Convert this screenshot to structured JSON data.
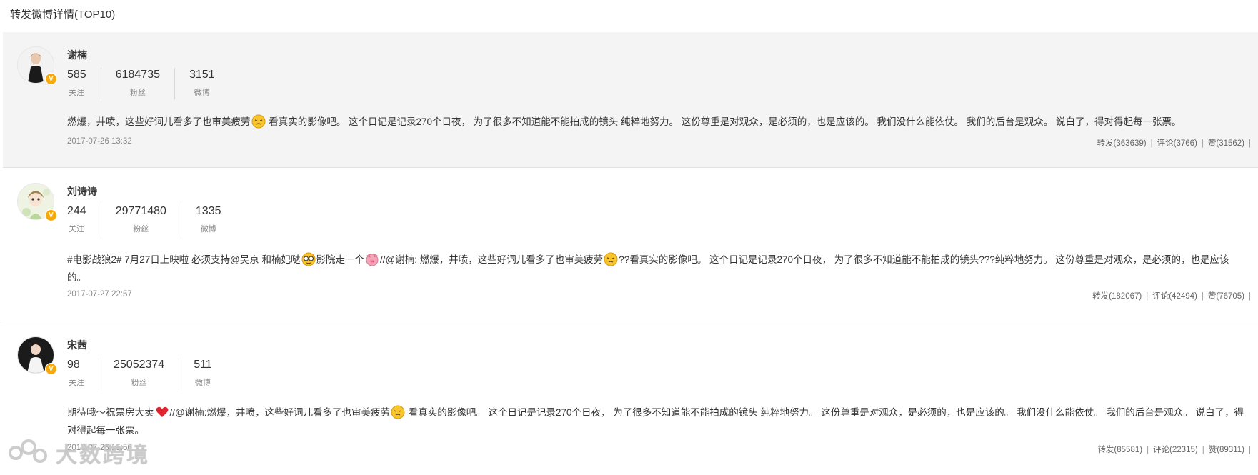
{
  "section_title": "转发微博详情(TOP10)",
  "labels": {
    "follow": "关注",
    "fans": "粉丝",
    "weibo": "微博"
  },
  "colors": {
    "badge": "#f7a90a",
    "highlight_bg": "#f4f4f4"
  },
  "posts": [
    {
      "name": "谢楠",
      "follow": "585",
      "fans": "6184735",
      "weibo": "3151",
      "content_a": "燃爆，井喷，这些好词儿看多了也审美疲劳",
      "content_b": " 看真实的影像吧。 这个日记是记录270个日夜， 为了很多不知道能不能拍成的镜头 纯粹地努力。 这份尊重是对观众，是必须的，也是应该的。 我们没什么能依仗。 我们的后台是观众。 说白了，得对得起每一张票。",
      "time": "2017-07-26 13:32",
      "repost": "转发(363639)",
      "comment": "评论(3766)",
      "like": "赞(31562)"
    },
    {
      "name": "刘诗诗",
      "follow": "244",
      "fans": "29771480",
      "weibo": "1335",
      "content_a": "#电影战狼2# 7月27日上映啦 必须支持@吴京 和楠妃哒",
      "content_b": "影院走一个",
      "content_c": "//@谢楠: 燃爆，井喷，这些好词儿看多了也审美疲劳",
      "content_d": "??看真实的影像吧。 这个日记是记录270个日夜， 为了很多不知道能不能拍成的镜头???纯粹地努力。 这份尊重是对观众，是必须的，也是应该的。",
      "time": "2017-07-27 22:57",
      "repost": "转发(182067)",
      "comment": "评论(42494)",
      "like": "赞(76705)"
    },
    {
      "name": "宋茜",
      "follow": "98",
      "fans": "25052374",
      "weibo": "511",
      "content_a": "期待哦～祝票房大卖",
      "content_b": "//@谢楠:燃爆，井喷，这些好词儿看多了也审美疲劳",
      "content_c": " 看真实的影像吧。 这个日记是记录270个日夜， 为了很多不知道能不能拍成的镜头 纯粹地努力。 这份尊重是对观众，是必须的，也是应该的。 我们没什么能依仗。 我们的后台是观众。 说白了，得对得起每一张票。",
      "time": "2017-07-28 15:56",
      "repost": "转发(85581)",
      "comment": "评论(22315)",
      "like": "赞(89311)"
    }
  ],
  "watermark": {
    "text": "大数跨境"
  }
}
